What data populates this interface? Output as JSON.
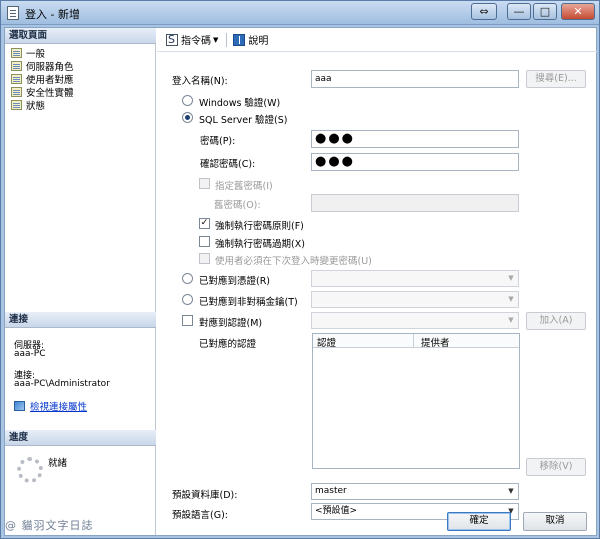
{
  "window": {
    "title": "登入 - 新增",
    "controls": {
      "restore": "⇔",
      "minimize": "—",
      "maximize": "□",
      "close": "✕"
    }
  },
  "left": {
    "select_page_header": "選取頁面",
    "pages": [
      {
        "label": "一般"
      },
      {
        "label": "伺服器角色"
      },
      {
        "label": "使用者對應"
      },
      {
        "label": "安全性實體"
      },
      {
        "label": "狀態"
      }
    ],
    "connection_header": "連接",
    "server_label": "伺服器:",
    "server_value": "aaa-PC",
    "connection_label": "連接:",
    "connection_value": "aaa-PC\\Administrator",
    "view_connection_link": "檢視連接屬性",
    "progress_header": "進度",
    "progress_status": "就緒"
  },
  "toolbar": {
    "script_label": "指令碼",
    "help_label": "說明"
  },
  "form": {
    "login_name_label": "登入名稱(N):",
    "login_name_value": "aaa",
    "search_button": "搜尋(E)...",
    "windows_auth_label": "Windows 驗證(W)",
    "sql_auth_label": "SQL Server 驗證(S)",
    "password_label": "密碼(P):",
    "password_value": "●●●",
    "confirm_password_label": "確認密碼(C):",
    "confirm_password_value": "●●●",
    "specify_old_password_label": "指定舊密碼(I)",
    "old_password_label": "舊密碼(O):",
    "enforce_policy_label": "強制執行密碼原則(F)",
    "enforce_expiration_label": "強制執行密碼過期(X)",
    "must_change_label": "使用者必須在下次登入時變更密碼(U)",
    "map_cert_label": "已對應到憑證(R)",
    "map_asym_key_label": "已對應到非對稱金鑰(T)",
    "map_credential_label": "對應到認證(M)",
    "add_button": "加入(A)",
    "mapped_credentials_label": "已對應的認證",
    "grid_columns": [
      "認證",
      "提供者"
    ],
    "remove_button": "移除(V)",
    "default_db_label": "預設資料庫(D):",
    "default_db_value": "master",
    "default_lang_label": "預設語言(G):",
    "default_lang_value": "<預設值>"
  },
  "buttons": {
    "ok": "確定",
    "cancel": "取消"
  },
  "watermark": "@ 貓羽文字日誌"
}
